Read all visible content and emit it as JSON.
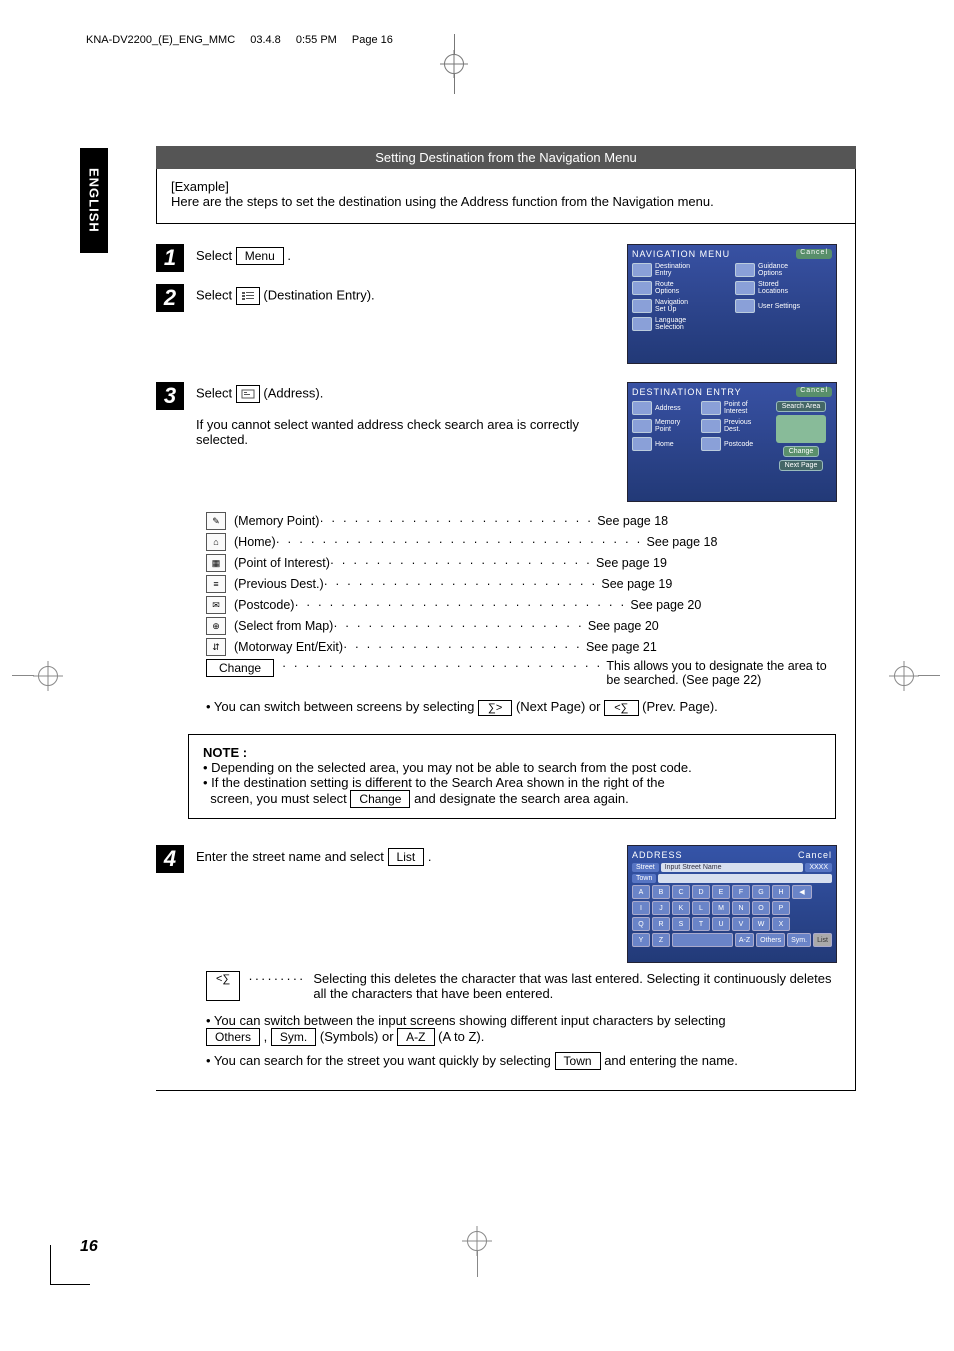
{
  "header": {
    "file": "KNA-DV2200_(E)_ENG_MMC",
    "date": "03.4.8",
    "time": "0:55 PM",
    "page_label": "Page 16"
  },
  "side_tab": "ENGLISH",
  "title": "Setting Destination from the Navigation Menu",
  "example": {
    "label": "[Example]",
    "text": "Here are the steps to set the destination using the Address function from the Navigation menu."
  },
  "steps": {
    "s1": {
      "num": "1",
      "pre": "Select",
      "btn": "Menu",
      "post": "."
    },
    "s2": {
      "num": "2",
      "pre": "Select",
      "post": "(Destination Entry)."
    },
    "s3": {
      "num": "3",
      "pre": "Select",
      "post": "(Address).",
      "note": "If you cannot select wanted address check search area is correctly selected."
    },
    "s4": {
      "num": "4",
      "pre": "Enter the street name and select",
      "btn": "List",
      "post": "."
    }
  },
  "nav_menu_ss": {
    "title": "NAVIGATION MENU",
    "cancel": "Cancel",
    "items": [
      {
        "l": "Destination",
        "sub": "Entry"
      },
      {
        "l": "Guidance",
        "sub": "Options"
      },
      {
        "l": "Route",
        "sub": "Options"
      },
      {
        "l": "Stored",
        "sub": "Locations"
      },
      {
        "l": "Navigation",
        "sub": "Set Up"
      },
      {
        "l": "User Settings",
        "sub": ""
      },
      {
        "l": "Language",
        "sub": "Selection"
      }
    ]
  },
  "dest_entry_ss": {
    "title": "DESTINATION ENTRY",
    "cancel": "Cancel",
    "search_area": "Search Area",
    "change": "Change",
    "next": "Next Page",
    "items": [
      {
        "l": "Address"
      },
      {
        "l": "Point of",
        "sub": "Interest"
      },
      {
        "l": "Memory",
        "sub": "Point"
      },
      {
        "l": "Previous",
        "sub": "Dest."
      },
      {
        "l": "Home"
      },
      {
        "l": "Postcode"
      }
    ]
  },
  "address_ss": {
    "title": "ADDRESS",
    "cancel": "Cancel",
    "street": "Street",
    "input_hint": "Input Street Name",
    "town": "Town",
    "list": "List",
    "others": "Others",
    "sym": "Sym.",
    "letters": [
      "A",
      "B",
      "C",
      "D",
      "E",
      "F",
      "G",
      "H",
      "I",
      "J",
      "K",
      "L",
      "M",
      "N",
      "O",
      "P",
      "Q",
      "R",
      "S",
      "T",
      "U",
      "V",
      "W",
      "X",
      "Y",
      "Z"
    ],
    "space_key": "",
    "az": "A-Z"
  },
  "refs": [
    {
      "label": "(Memory Point)",
      "page": "See page 18"
    },
    {
      "label": "(Home)",
      "page": "See page 18"
    },
    {
      "label": "(Point of Interest)",
      "page": "See page 19"
    },
    {
      "label": "(Previous Dest.)",
      "page": "See page 19"
    },
    {
      "label": "(Postcode)",
      "page": "See page 20"
    },
    {
      "label": "(Select from Map)",
      "page": "See page 20"
    },
    {
      "label": "(Motorway Ent/Exit)",
      "page": "See page 21"
    }
  ],
  "change_row": {
    "btn": "Change",
    "text": "This allows you to designate the area to be searched. (See page 22)"
  },
  "switch_line": {
    "pre": "• You can switch between screens by selecting",
    "next": "(Next Page) or",
    "prev": "(Prev. Page)."
  },
  "note": {
    "title": "NOTE :",
    "l1": "• Depending on the selected area, you may not be able to search from the post code.",
    "l2a": "• If the destination setting is different to the Search Area shown in the right of the",
    "l2b": "screen, you must select",
    "l2btn": "Change",
    "l2c": "and designate the search area again."
  },
  "delete_line": {
    "text": "Selecting this deletes the character that was last entered. Selecting it continuously deletes all the characters that have been entered."
  },
  "switch_input": {
    "pre": "• You can switch between the input screens showing different input characters by selecting",
    "others": "Others",
    "sep1": ",",
    "sym": "Sym.",
    "sym_post": "(Symbols) or",
    "az": "A-Z",
    "az_post": "(A to Z)."
  },
  "search_town": {
    "pre": "• You can search for the street you want quickly by selecting",
    "btn": "Town",
    "post": "and entering the name."
  },
  "page_number": "16"
}
